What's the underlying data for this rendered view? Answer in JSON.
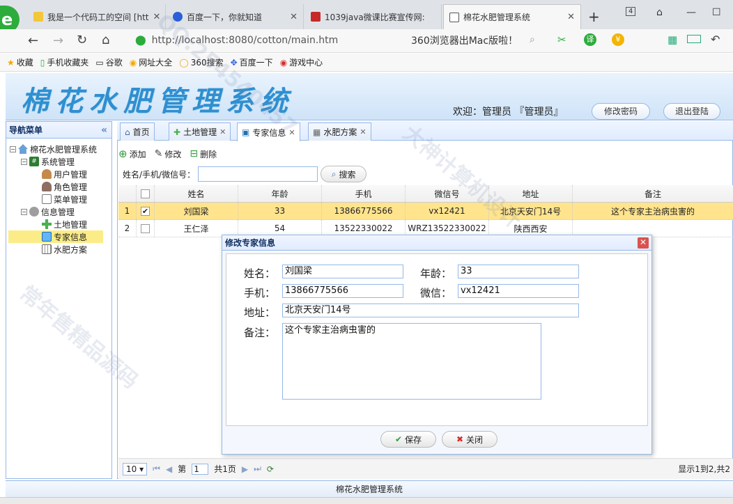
{
  "browser": {
    "tabs": [
      {
        "label": "我是一个代码工的空间 [htt"
      },
      {
        "label": "百度一下，你就知道"
      },
      {
        "label": "1039java微课比赛宣传网:"
      },
      {
        "label": "棉花水肥管理系统"
      }
    ],
    "new_tab": "+",
    "tab_count": "4",
    "url": "http://localhost:8080/cotton/main.htm",
    "promo": "360浏览器出Mac版啦！",
    "bookmarks": [
      "收藏",
      "手机收藏夹",
      "谷歌",
      "网址大全",
      "360搜索",
      "百度一下",
      "游戏中心"
    ]
  },
  "app": {
    "title": "棉花水肥管理系统",
    "welcome": "欢迎：管理员 『管理员』",
    "change_password": "修改密码",
    "logout": "退出登陆",
    "footer": "棉花水肥管理系统"
  },
  "sidebar": {
    "title": "导航菜单",
    "collapse_icon": "«",
    "root": "棉花水肥管理系统",
    "groups": [
      {
        "label": "系统管理",
        "items": [
          "用户管理",
          "角色管理",
          "菜单管理"
        ]
      },
      {
        "label": "信息管理",
        "items": [
          "土地管理",
          "专家信息",
          "水肥方案"
        ]
      }
    ]
  },
  "page_tabs": [
    "首页",
    "土地管理",
    "专家信息",
    "水肥方案"
  ],
  "toolbar": {
    "add": "添加",
    "edit": "修改",
    "delete": "删除"
  },
  "search": {
    "label": "姓名/手机/微信号：",
    "button": "搜索"
  },
  "grid": {
    "columns": [
      "姓名",
      "年龄",
      "手机",
      "微信号",
      "地址",
      "备注"
    ],
    "rows": [
      {
        "n": "1",
        "checked": true,
        "name": "刘国梁",
        "age": "33",
        "phone": "13866775566",
        "wechat": "vx12421",
        "addr": "北京天安门14号",
        "note": "这个专家主治病虫害的"
      },
      {
        "n": "2",
        "checked": false,
        "name": "王仁泽",
        "age": "54",
        "phone": "13522330022",
        "wechat": "WRZ13522330022",
        "addr": "陕西西安",
        "note": ""
      }
    ]
  },
  "pager": {
    "size": "10",
    "page_prefix": "第",
    "page": "1",
    "page_total": "共1页",
    "info": "显示1到2,共2"
  },
  "dialog": {
    "title": "修改专家信息",
    "labels": {
      "name": "姓名：",
      "age": "年龄：",
      "phone": "手机：",
      "wechat": "微信：",
      "addr": "地址：",
      "note": "备注："
    },
    "values": {
      "name": "刘国梁",
      "age": "33",
      "phone": "13866775566",
      "wechat": "vx12421",
      "addr": "北京天安门14号",
      "note": "这个专家主治病虫害的"
    },
    "save": "保存",
    "close": "关闭"
  },
  "watermarks": [
    "QQ:254540457",
    "大神计算机设计",
    "常年售精品源码"
  ],
  "colors": {
    "accent": "#2f8fd0",
    "border": "#95b8e7",
    "selected_row": "#ffe48d"
  }
}
